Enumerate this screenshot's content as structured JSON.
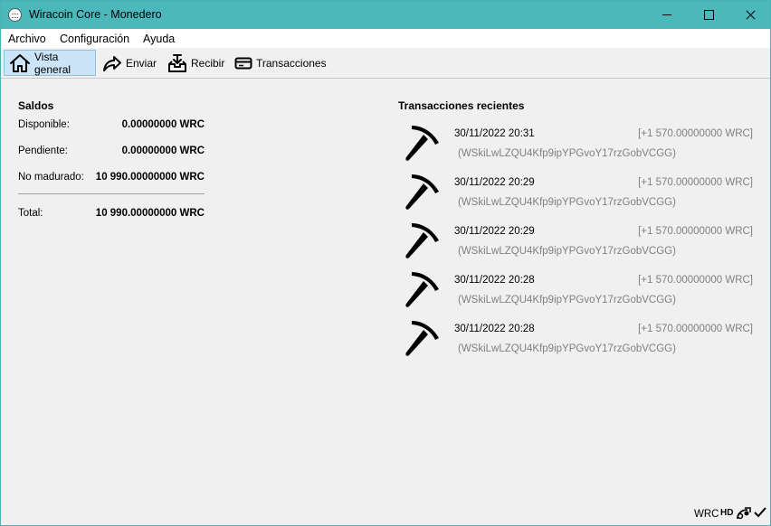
{
  "window": {
    "title": "Wiracoin Core - Monedero"
  },
  "menu": {
    "items": [
      "Archivo",
      "Configuración",
      "Ayuda"
    ]
  },
  "toolbar": {
    "items": [
      {
        "label": "Vista general",
        "icon": "home-icon",
        "active": true
      },
      {
        "label": "Enviar",
        "icon": "send-arrow-icon",
        "active": false
      },
      {
        "label": "Recibir",
        "icon": "receive-inbox-icon",
        "active": false
      },
      {
        "label": "Transacciones",
        "icon": "card-icon",
        "active": false
      }
    ]
  },
  "balances": {
    "title": "Saldos",
    "available_label": "Disponible:",
    "available_value": "0.00000000 WRC",
    "pending_label": "Pendiente:",
    "pending_value": "0.00000000 WRC",
    "immature_label": "No madurado:",
    "immature_value": "10 990.00000000 WRC",
    "total_label": "Total:",
    "total_value": "10 990.00000000 WRC"
  },
  "recent": {
    "title": "Transacciones recientes",
    "transactions": [
      {
        "date": "30/11/2022 20:31",
        "amount": "[+1 570.00000000 WRC]",
        "address": "(WSkiLwLZQU4Kfp9ipYPGvoY17rzGobVCGG)",
        "icon": "pickaxe-icon"
      },
      {
        "date": "30/11/2022 20:29",
        "amount": "[+1 570.00000000 WRC]",
        "address": "(WSkiLwLZQU4Kfp9ipYPGvoY17rzGobVCGG)",
        "icon": "pickaxe-icon"
      },
      {
        "date": "30/11/2022 20:29",
        "amount": "[+1 570.00000000 WRC]",
        "address": "(WSkiLwLZQU4Kfp9ipYPGvoY17rzGobVCGG)",
        "icon": "pickaxe-icon"
      },
      {
        "date": "30/11/2022 20:28",
        "amount": "[+1 570.00000000 WRC]",
        "address": "(WSkiLwLZQU4Kfp9ipYPGvoY17rzGobVCGG)",
        "icon": "pickaxe-icon"
      },
      {
        "date": "30/11/2022 20:28",
        "amount": "[+1 570.00000000 WRC]",
        "address": "(WSkiLwLZQU4Kfp9ipYPGvoY17rzGobVCGG)",
        "icon": "pickaxe-icon"
      }
    ]
  },
  "statusbar": {
    "unit": "WRC",
    "hd": "HD"
  },
  "colors": {
    "titlebar": "#4bb8bb",
    "active_tab": "#cce4f7"
  }
}
